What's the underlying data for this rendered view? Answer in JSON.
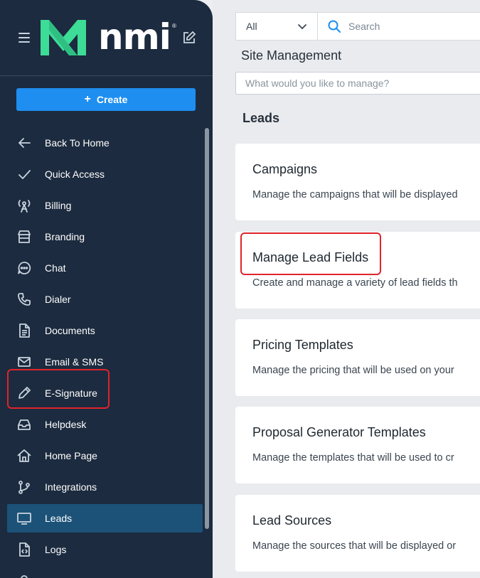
{
  "sidebar": {
    "brand": "nmi",
    "registered": "®",
    "create_label": "Create",
    "items": [
      {
        "label": "Back To Home",
        "icon": "arrow-left-icon"
      },
      {
        "label": "Quick Access",
        "icon": "check-icon"
      },
      {
        "label": "Billing",
        "icon": "antenna-icon"
      },
      {
        "label": "Branding",
        "icon": "storefront-icon"
      },
      {
        "label": "Chat",
        "icon": "chat-bubble-icon"
      },
      {
        "label": "Dialer",
        "icon": "phone-icon"
      },
      {
        "label": "Documents",
        "icon": "document-icon"
      },
      {
        "label": "Email & SMS",
        "icon": "envelope-icon"
      },
      {
        "label": "E-Signature",
        "icon": "pen-icon"
      },
      {
        "label": "Helpdesk",
        "icon": "inbox-icon"
      },
      {
        "label": "Home Page",
        "icon": "house-icon"
      },
      {
        "label": "Integrations",
        "icon": "git-branch-icon"
      },
      {
        "label": "Leads",
        "icon": "monitor-icon"
      },
      {
        "label": "Logs",
        "icon": "code-file-icon"
      },
      {
        "label": "",
        "icon": "pin-icon"
      }
    ],
    "active_item": "Leads"
  },
  "header": {
    "filter_value": "All",
    "search_placeholder": "Search"
  },
  "main": {
    "page_title": "Site Management",
    "manage_placeholder": "What would you like to manage?",
    "section_title": "Leads",
    "cards": [
      {
        "title": "Campaigns",
        "description": "Manage the campaigns that will be displayed"
      },
      {
        "title": "Manage Lead Fields",
        "description": "Create and manage a variety of lead fields th"
      },
      {
        "title": "Pricing Templates",
        "description": "Manage the pricing that will be used on your"
      },
      {
        "title": "Proposal Generator Templates",
        "description": "Manage the templates that will be used to cr"
      },
      {
        "title": "Lead Sources",
        "description": "Manage the sources that will be displayed or"
      }
    ]
  },
  "colors": {
    "sidebar_bg": "#1c2b3f",
    "create_button": "#1e8ef0",
    "active_item_bg": "#1c5278",
    "brand_green": "#3ddc97",
    "highlight_red": "#e0242b"
  }
}
